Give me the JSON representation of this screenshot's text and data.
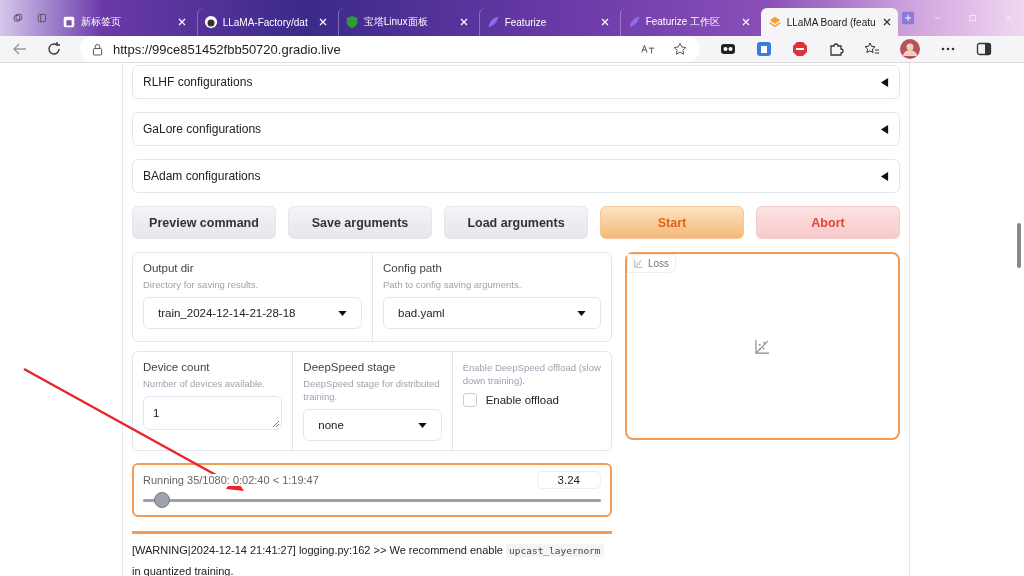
{
  "browser": {
    "tabs": [
      {
        "title": "新标签页",
        "selected": false
      },
      {
        "title": "LLaMA-Factory/dat",
        "selected": false
      },
      {
        "title": "宝塔Linux面板",
        "selected": false
      },
      {
        "title": "Featurize",
        "selected": false
      },
      {
        "title": "Featurize 工作区",
        "selected": false
      },
      {
        "title": "LLaMA Board (featu",
        "selected": true
      }
    ],
    "address": "https://99ce851452fbb50720.gradio.live"
  },
  "accordions": [
    {
      "label": "RLHF configurations",
      "expanded": false
    },
    {
      "label": "GaLore configurations",
      "expanded": false
    },
    {
      "label": "BAdam configurations",
      "expanded": false
    }
  ],
  "buttons": [
    {
      "label": "Preview command",
      "kind": "secondary"
    },
    {
      "label": "Save arguments",
      "kind": "secondary"
    },
    {
      "label": "Load arguments",
      "kind": "secondary"
    },
    {
      "label": "Start",
      "kind": "primary"
    },
    {
      "label": "Abort",
      "kind": "stop"
    }
  ],
  "output_dir": {
    "label": "Output dir",
    "info": "Directory for saving results.",
    "value": "train_2024-12-14-21-28-18"
  },
  "config_path": {
    "label": "Config path",
    "info": "Path to config saving arguments.",
    "value": "bad.yaml"
  },
  "device_count": {
    "label": "Device count",
    "info": "Number of devices available.",
    "value": "1"
  },
  "deepspeed_stage": {
    "label": "DeepSpeed stage",
    "info": "DeepSpeed stage for distributed training.",
    "value": "none"
  },
  "offload": {
    "info": "Enable DeepSpeed offload (slow down training).",
    "label": "Enable offload",
    "checked": false
  },
  "loss_plot": {
    "label": "Loss"
  },
  "progress": {
    "label": "Running 35/1080: 0:02:40 < 1:19:47",
    "value": "3.24",
    "level": 0.046
  },
  "log": {
    "before": "[WARNING|2024-12-14 21:41:27] logging.py:162 >> We recommend enable ",
    "code": "upcast_layernorm",
    "after": " in quantized training."
  }
}
